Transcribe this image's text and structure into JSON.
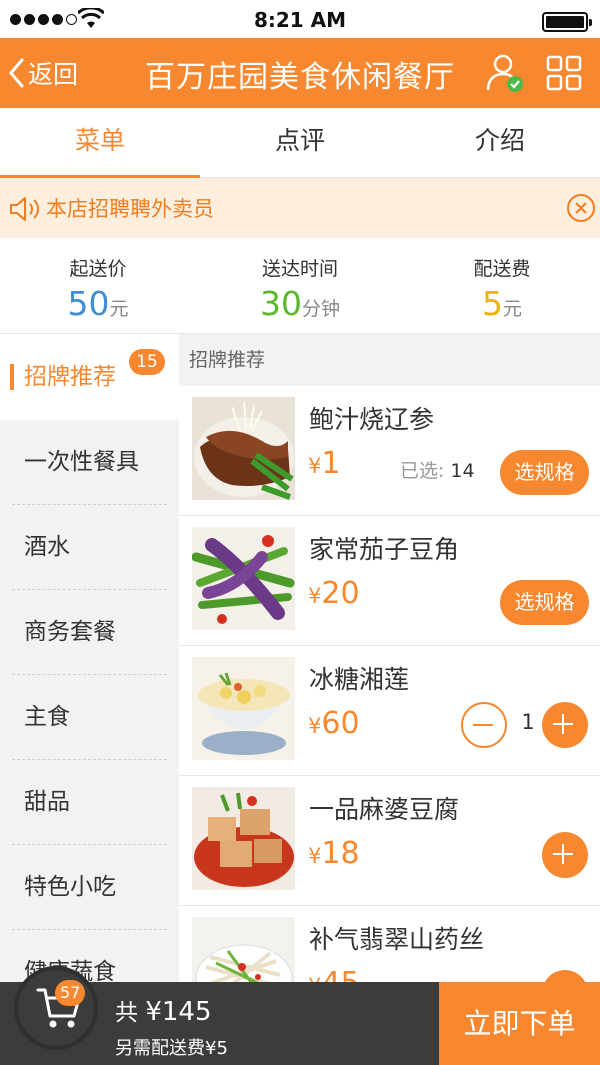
{
  "status_bar": {
    "time": "8:21 AM"
  },
  "nav": {
    "back_label": "返回",
    "title": "百万庄园美食休闲餐厅"
  },
  "tabs": [
    {
      "label": "菜单",
      "active": true
    },
    {
      "label": "点评",
      "active": false
    },
    {
      "label": "介绍",
      "active": false
    }
  ],
  "notice": {
    "text": "本店招聘聘外卖员"
  },
  "delivery": {
    "min_order": {
      "label": "起送价",
      "value": "50",
      "unit": "元",
      "color": "#3f8fd2"
    },
    "delivery_time": {
      "label": "送达时间",
      "value": "30",
      "unit": "分钟",
      "color": "#5ab82a"
    },
    "delivery_fee": {
      "label": "配送费",
      "value": "5",
      "unit": "元",
      "color": "#f2b300"
    }
  },
  "sidebar": {
    "items": [
      {
        "label": "招牌推荐",
        "badge": "15",
        "active": true
      },
      {
        "label": "一次性餐具"
      },
      {
        "label": "酒水"
      },
      {
        "label": "商务套餐"
      },
      {
        "label": "主食"
      },
      {
        "label": "甜品"
      },
      {
        "label": "特色小吃"
      },
      {
        "label": "健康蔬食"
      }
    ]
  },
  "menu": {
    "section_title": "招牌推荐",
    "currency": "¥",
    "selected_label": "已选:",
    "spec_label": "选规格",
    "dishes": [
      {
        "name": "鲍汁烧辽参",
        "price": "1",
        "selected_count": "14",
        "action": "spec"
      },
      {
        "name": "家常茄子豆角",
        "price": "20",
        "action": "spec"
      },
      {
        "name": "冰糖湘莲",
        "price": "60",
        "quantity": "1",
        "action": "stepper"
      },
      {
        "name": "一品麻婆豆腐",
        "price": "18",
        "action": "add"
      },
      {
        "name": "补气翡翠山药丝",
        "price": "45",
        "action": "add"
      }
    ]
  },
  "cart": {
    "count": "57",
    "total_prefix": "共",
    "total": "¥145",
    "fee_text": "另需配送费¥5",
    "order_label": "立即下单"
  },
  "colors": {
    "accent": "#f7882f",
    "cart_bar": "#3c3c3c"
  }
}
